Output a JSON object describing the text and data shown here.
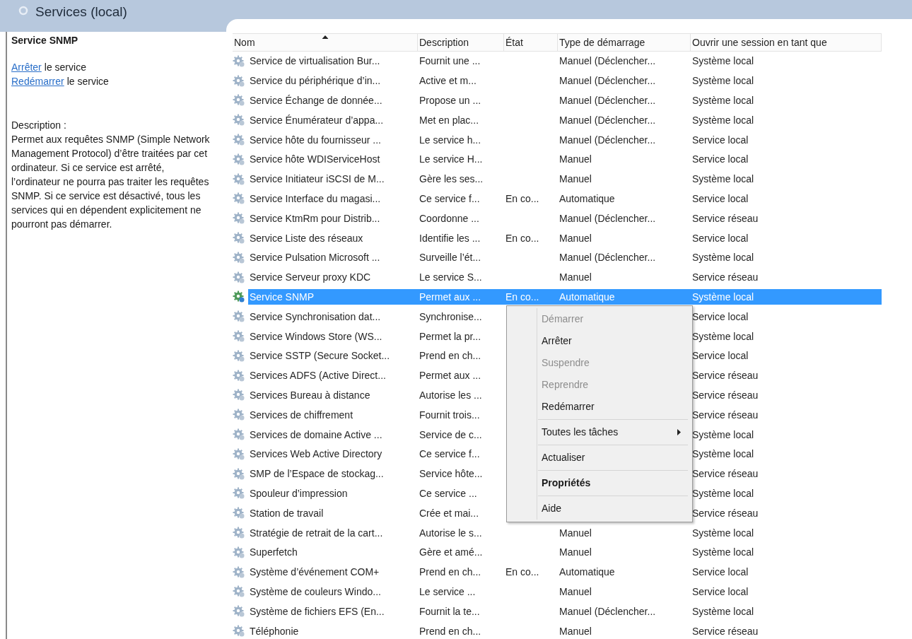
{
  "header": {
    "title": "Services (local)"
  },
  "details": {
    "service_name": "Service SNMP",
    "actions": [
      {
        "link": "Arrêter",
        "text": "le service"
      },
      {
        "link": "Redémarrer",
        "text": "le service"
      }
    ],
    "description_label": "Description :",
    "description": "Permet aux requêtes SNMP (Simple Network Management Protocol) d’être traitées par cet ordinateur. Si ce service est arrêté, l’ordinateur ne pourra pas traiter les requêtes SNMP. Si ce service est désactivé, tous les services qui en dépendent explicitement ne pourront pas démarrer."
  },
  "table": {
    "columns": [
      {
        "label": "Nom",
        "sorted": true
      },
      {
        "label": "Description",
        "sorted": false
      },
      {
        "label": "État",
        "sorted": false
      },
      {
        "label": "Type de démarrage",
        "sorted": false
      },
      {
        "label": "Ouvrir une session en tant que",
        "sorted": false
      }
    ],
    "rows": [
      {
        "name": "Service de virtualisation Bur...",
        "description": "Fournit une ...",
        "startup": "Manuel (Déclencher...",
        "logon": "Système local",
        "selected": false
      },
      {
        "name": "Service du périphérique d’in...",
        "description": "Active et m...",
        "startup": "Manuel (Déclencher...",
        "logon": "Système local",
        "selected": false
      },
      {
        "name": "Service Échange de donnée...",
        "description": "Propose un ...",
        "startup": "Manuel (Déclencher...",
        "logon": "Système local",
        "selected": false
      },
      {
        "name": "Service Énumérateur d’appa...",
        "description": "Met en plac...",
        "startup": "Manuel (Déclencher...",
        "logon": "Système local",
        "selected": false
      },
      {
        "name": "Service hôte du fournisseur ...",
        "description": "Le service h...",
        "startup": "Manuel (Déclencher...",
        "logon": "Service local",
        "selected": false
      },
      {
        "name": "Service hôte WDIServiceHost",
        "description": "Le service H...",
        "startup": "Manuel",
        "logon": "Service local",
        "selected": false
      },
      {
        "name": "Service Initiateur iSCSI de M...",
        "description": "Gère les ses...",
        "startup": "Manuel",
        "logon": "Système local",
        "selected": false
      },
      {
        "name": "Service Interface du magasi...",
        "description": "Ce service f...",
        "state": "En co...",
        "startup": "Automatique",
        "logon": "Service local",
        "selected": false
      },
      {
        "name": "Service KtmRm pour Distrib...",
        "description": "Coordonne ...",
        "startup": "Manuel (Déclencher...",
        "logon": "Service réseau",
        "selected": false
      },
      {
        "name": "Service Liste des réseaux",
        "description": "Identifie les ...",
        "state": "En co...",
        "startup": "Manuel",
        "logon": "Service local",
        "selected": false
      },
      {
        "name": "Service Pulsation Microsoft ...",
        "description": "Surveille l’ét...",
        "startup": "Manuel (Déclencher...",
        "logon": "Système local",
        "selected": false
      },
      {
        "name": "Service Serveur proxy KDC",
        "description": "Le service S...",
        "startup": "Manuel",
        "logon": "Service réseau",
        "selected": false
      },
      {
        "name": "Service SNMP",
        "description": "Permet aux ...",
        "state": "En co...",
        "startup": "Automatique",
        "logon": "Système local",
        "selected": true
      },
      {
        "name": "Service Synchronisation dat...",
        "description": "Synchronise...",
        "logon": "Service local",
        "selected": false
      },
      {
        "name": "Service Windows Store (WS...",
        "description": "Permet la pr...",
        "logon": "Système local",
        "selected": false
      },
      {
        "name": "Service SSTP (Secure Socket...",
        "description": "Prend en ch...",
        "logon": "Service local",
        "selected": false
      },
      {
        "name": "Services ADFS (Active Direct...",
        "description": "Permet aux ...",
        "logon": "Service réseau",
        "selected": false
      },
      {
        "name": "Services Bureau à distance",
        "description": "Autorise les ...",
        "logon": "Service réseau",
        "selected": false
      },
      {
        "name": "Services de chiffrement",
        "description": "Fournit trois...",
        "logon": "Service réseau",
        "selected": false
      },
      {
        "name": "Services de domaine Active ...",
        "description": "Service de c...",
        "logon": "Système local",
        "selected": false
      },
      {
        "name": "Services Web Active Directory",
        "description": "Ce service f...",
        "logon": "Système local",
        "selected": false
      },
      {
        "name": "SMP de l’Espace de stockag...",
        "description": "Service hôte...",
        "logon": "Service réseau",
        "selected": false
      },
      {
        "name": "Spouleur d’impression",
        "description": "Ce service ...",
        "logon": "Système local",
        "selected": false
      },
      {
        "name": "Station de travail",
        "description": "Crée et mai...",
        "logon": "Service réseau",
        "selected": false
      },
      {
        "name": "Stratégie de retrait de la cart...",
        "description": "Autorise le s...",
        "startup": "Manuel",
        "logon": "Système local",
        "selected": false
      },
      {
        "name": "Superfetch",
        "description": "Gère et amé...",
        "startup": "Manuel",
        "logon": "Système local",
        "selected": false
      },
      {
        "name": "Système d’événement COM+",
        "description": "Prend en ch...",
        "state": "En co...",
        "startup": "Automatique",
        "logon": "Service local",
        "selected": false
      },
      {
        "name": "Système de couleurs Windo...",
        "description": "Le service ...",
        "startup": "Manuel",
        "logon": "Service local",
        "selected": false
      },
      {
        "name": "Système de fichiers EFS (En...",
        "description": "Fournit la te...",
        "startup": "Manuel (Déclencher...",
        "logon": "Système local",
        "selected": false
      },
      {
        "name": "Téléphonie",
        "description": "Prend en ch...",
        "startup": "Manuel",
        "logon": "Service réseau",
        "selected": false
      }
    ]
  },
  "context_menu": {
    "items": [
      {
        "kind": "item",
        "label": "Démarrer",
        "disabled": true,
        "default": false,
        "submenu": false
      },
      {
        "kind": "item",
        "label": "Arrêter",
        "disabled": false,
        "default": false,
        "submenu": false
      },
      {
        "kind": "item",
        "label": "Suspendre",
        "disabled": true,
        "default": false,
        "submenu": false
      },
      {
        "kind": "item",
        "label": "Reprendre",
        "disabled": true,
        "default": false,
        "submenu": false
      },
      {
        "kind": "item",
        "label": "Redémarrer",
        "disabled": false,
        "default": false,
        "submenu": false
      },
      {
        "kind": "separator"
      },
      {
        "kind": "item",
        "label": "Toutes les tâches",
        "disabled": false,
        "default": false,
        "submenu": true
      },
      {
        "kind": "separator"
      },
      {
        "kind": "item",
        "label": "Actualiser",
        "disabled": false,
        "default": false,
        "submenu": false
      },
      {
        "kind": "separator"
      },
      {
        "kind": "item",
        "label": "Propriétés",
        "disabled": false,
        "default": true,
        "submenu": false
      },
      {
        "kind": "separator"
      },
      {
        "kind": "item",
        "label": "Aide",
        "disabled": false,
        "default": false,
        "submenu": false
      }
    ]
  }
}
